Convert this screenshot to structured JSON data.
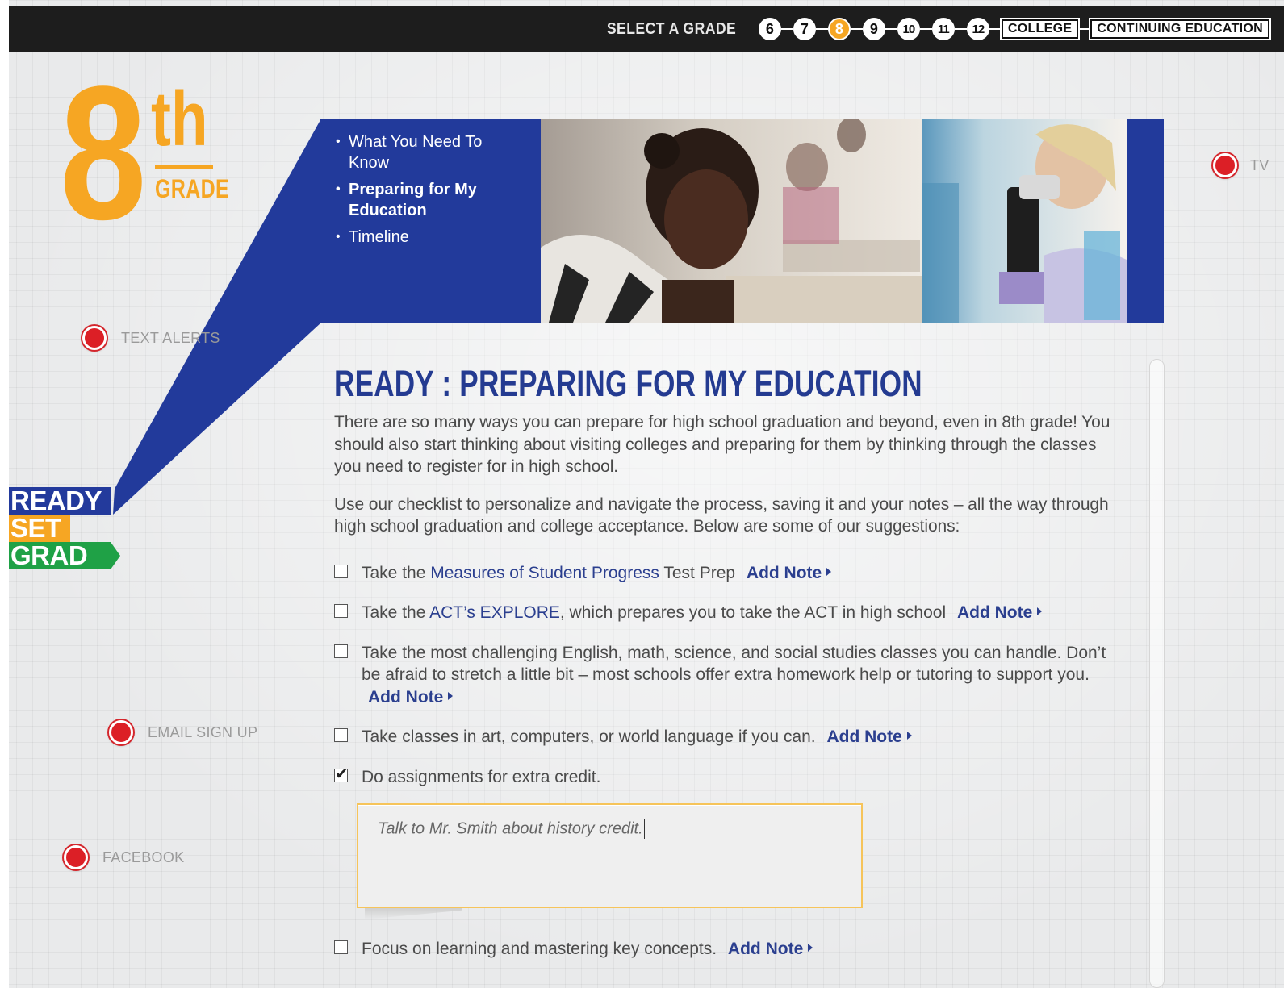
{
  "topbar": {
    "select_label": "SELECT A GRADE",
    "grades": [
      "6",
      "7",
      "8",
      "9",
      "10",
      "11",
      "12"
    ],
    "active_grade": "8",
    "college": "COLLEGE",
    "continuing": "CONTINUING EDUCATION"
  },
  "grade_logo": {
    "number": "8",
    "suffix": "th",
    "word": "GRADE"
  },
  "brand": {
    "ready": "READY",
    "set": "SET",
    "grad": "GRAD"
  },
  "social": {
    "text_alerts": "TEXT ALERTS",
    "email": "EMAIL SIGN UP",
    "facebook": "FACEBOOK",
    "right_partial": "TV"
  },
  "hero": {
    "nav": [
      {
        "label": "What You Need To Know"
      },
      {
        "label": "Preparing for My Education"
      },
      {
        "label": "Timeline"
      }
    ]
  },
  "main": {
    "title": "READY : PREPARING FOR MY EDUCATION",
    "para1": "There are so many ways you can prepare for high school graduation and beyond, even in 8th grade! You should also start thinking about visiting colleges and preparing for them by thinking through the classes you need to register for in high school.",
    "para2": "Use our checklist to personalize and navigate the process, saving it and your notes – all the way through high school graduation and college acceptance. Below are some of our suggestions:",
    "add_note": "Add Note",
    "items": {
      "i1": {
        "pre": "Take the ",
        "link": "Measures of Student Progress",
        "post": " Test Prep"
      },
      "i2": {
        "pre": "Take the ",
        "link": "ACT’s EXPLORE",
        "post": ", which prepares you to take the ACT in high school"
      },
      "i3": {
        "text": "Take the most challenging English, math, science, and social studies classes you can handle. Don’t be afraid to stretch a little bit – most schools offer extra homework help or tutoring to support you."
      },
      "i4": {
        "text": "Take classes in art, computers, or world language if you can."
      },
      "i5": {
        "text": "Do assignments for extra credit.",
        "checked": true
      },
      "i6": {
        "text": "Focus on learning and mastering key concepts."
      }
    },
    "note_text": "Talk to Mr. Smith about history credit."
  },
  "colors": {
    "blue": "#223a9b",
    "orange": "#f6a623",
    "green": "#1fa146",
    "red": "#dc1f26"
  }
}
